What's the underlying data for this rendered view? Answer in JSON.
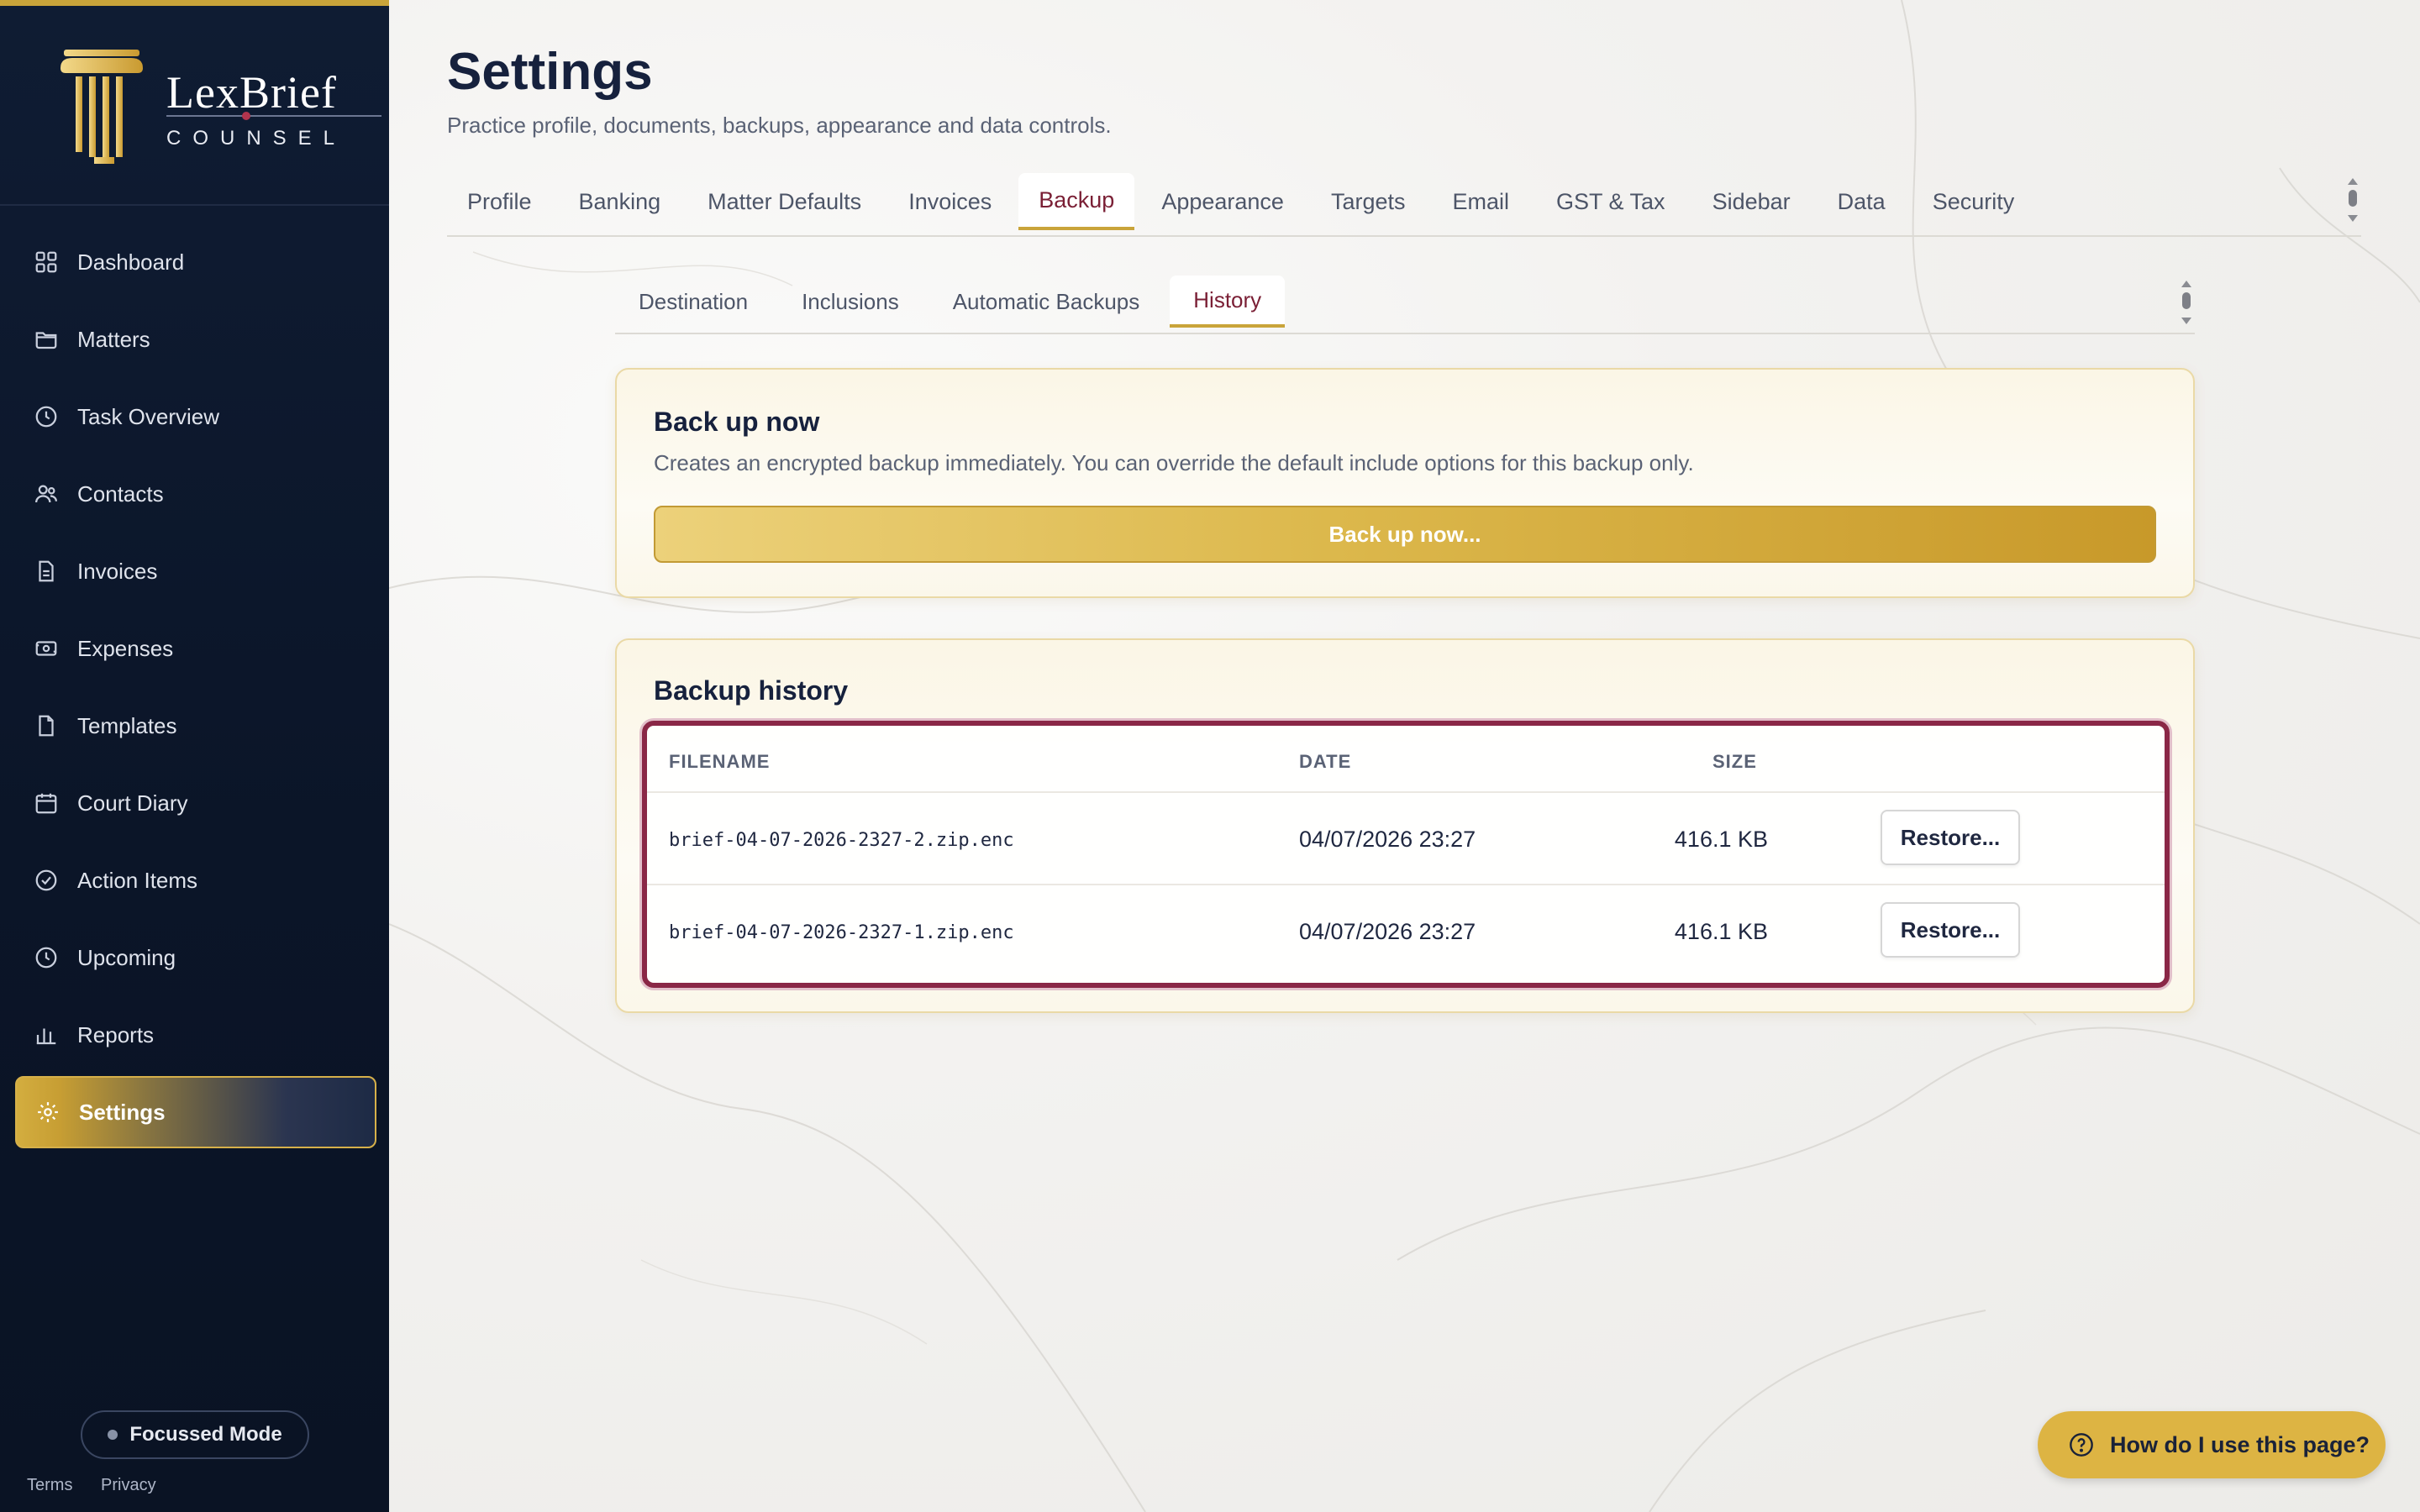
{
  "brand": {
    "name": "LexBrief",
    "sub": "COUNSEL"
  },
  "sidebar": {
    "items": [
      {
        "label": "Dashboard",
        "icon": "dashboard-icon"
      },
      {
        "label": "Matters",
        "icon": "folder-icon"
      },
      {
        "label": "Task Overview",
        "icon": "clock-icon"
      },
      {
        "label": "Contacts",
        "icon": "users-icon"
      },
      {
        "label": "Invoices",
        "icon": "document-icon"
      },
      {
        "label": "Expenses",
        "icon": "banknote-icon"
      },
      {
        "label": "Templates",
        "icon": "file-icon"
      },
      {
        "label": "Court Diary",
        "icon": "calendar-icon"
      },
      {
        "label": "Action Items",
        "icon": "check-circle-icon"
      },
      {
        "label": "Upcoming",
        "icon": "clock-icon"
      },
      {
        "label": "Reports",
        "icon": "bar-chart-icon"
      },
      {
        "label": "Settings",
        "icon": "gear-icon",
        "active": true
      }
    ],
    "focus_mode": "Focussed Mode",
    "terms": "Terms",
    "privacy": "Privacy"
  },
  "page": {
    "title": "Settings",
    "subtitle": "Practice profile, documents, backups, appearance and data controls."
  },
  "tabs": [
    "Profile",
    "Banking",
    "Matter Defaults",
    "Invoices",
    "Backup",
    "Appearance",
    "Targets",
    "Email",
    "GST & Tax",
    "Sidebar",
    "Data",
    "Security"
  ],
  "active_tab": "Backup",
  "subtabs": [
    "Destination",
    "Inclusions",
    "Automatic Backups",
    "History"
  ],
  "active_subtab": "History",
  "backup_now": {
    "title": "Back up now",
    "description": "Creates an encrypted backup immediately. You can override the default include options for this backup only.",
    "button": "Back up now..."
  },
  "history": {
    "title": "Backup history",
    "columns": {
      "filename": "FILENAME",
      "date": "DATE",
      "size": "SIZE"
    },
    "rows": [
      {
        "filename": "brief-04-07-2026-2327-2.zip.enc",
        "date": "04/07/2026 23:27",
        "size": "416.1 KB",
        "action": "Restore..."
      },
      {
        "filename": "brief-04-07-2026-2327-1.zip.enc",
        "date": "04/07/2026 23:27",
        "size": "416.1 KB",
        "action": "Restore..."
      }
    ]
  },
  "help": {
    "label": "How do I use this page?",
    "icon": "help-circle-icon"
  },
  "colors": {
    "gold": "#c9a43a",
    "navy": "#0f1c33",
    "accent": "#7a1f35",
    "highlight_border": "#8a2746"
  }
}
